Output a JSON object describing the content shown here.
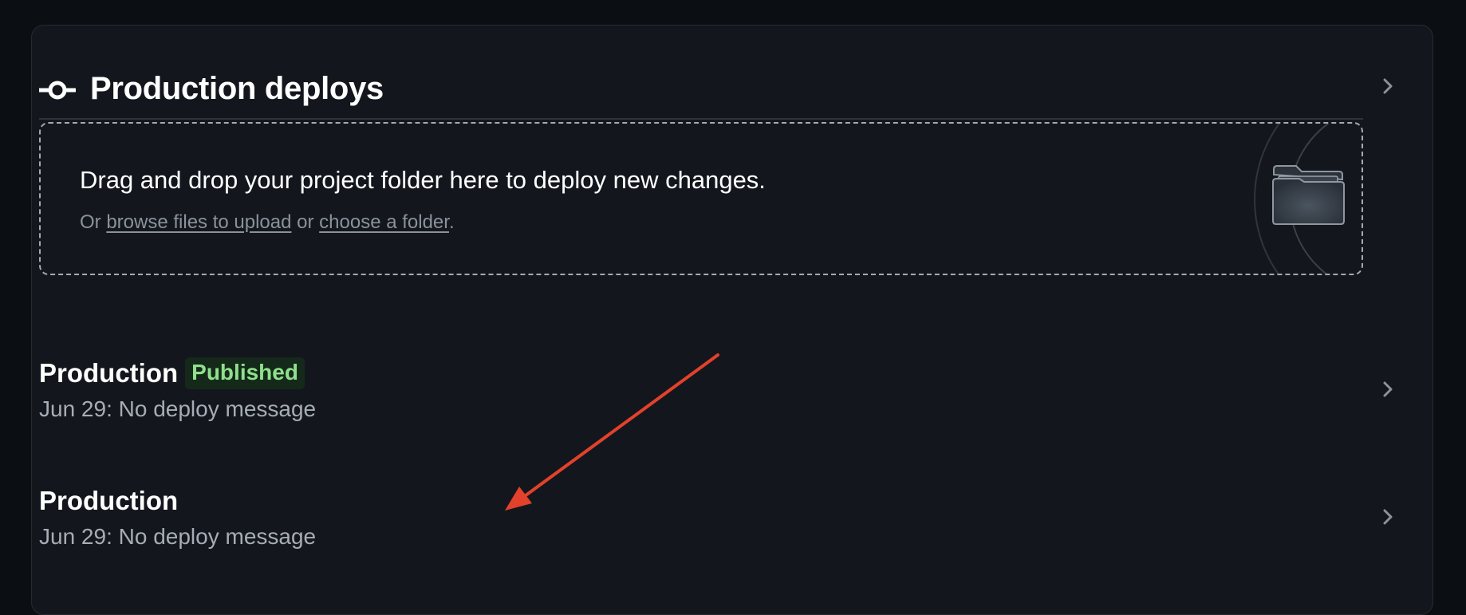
{
  "header": {
    "title": "Production deploys",
    "icon": "commit-icon"
  },
  "dropzone": {
    "title": "Drag and drop your project folder here to deploy new changes.",
    "sub_prefix": "Or ",
    "browse_link": "browse files to upload",
    "sub_middle": " or ",
    "folder_link": "choose a folder",
    "sub_suffix": ".",
    "icon": "folder-icon"
  },
  "deploys": [
    {
      "title": "Production",
      "badge": "Published",
      "meta": "Jun 29: No deploy message"
    },
    {
      "title": "Production",
      "meta": "Jun 29: No deploy message"
    }
  ],
  "colors": {
    "background": "#0b0e12",
    "card": "#13171d",
    "published_badge_bg": "#15291a",
    "published_badge_text": "#8fe08c",
    "annotation_arrow": "#e3412b"
  }
}
